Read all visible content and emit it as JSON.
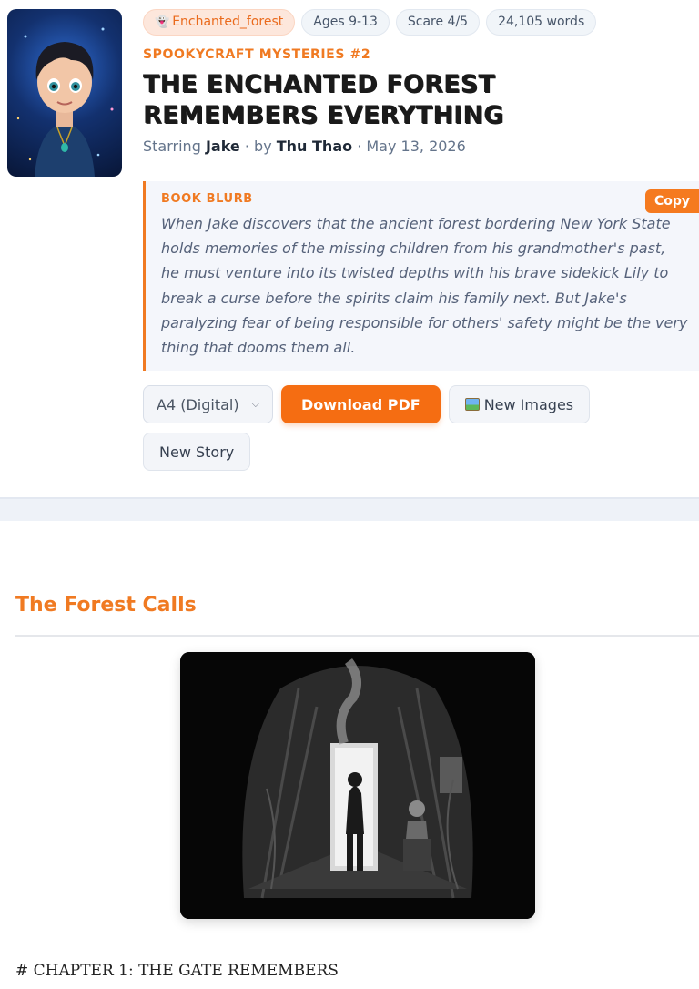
{
  "book": {
    "tags": {
      "theme": "Enchanted_forest",
      "theme_icon": "ghost-icon",
      "ages": "Ages 9-13",
      "scare": "Scare 4/5",
      "words": "24,105 words"
    },
    "series": "SPOOKYCRAFT MYSTERIES #2",
    "title": "THE ENCHANTED FOREST REMEMBERS EVERYTHING",
    "byline": {
      "starring_label": "Starring",
      "hero": "Jake",
      "by_label": "· by",
      "author": "Thu Thao",
      "date": "· May 13, 2026"
    }
  },
  "blurb": {
    "label": "BOOK BLURB",
    "copy_label": "Copy",
    "text": "When Jake discovers that the ancient forest bordering New York State holds memories of the missing children from his grandmother's past, he must venture into its twisted depths with his brave sidekick Lily to break a curse before the spirits claim his family next. But Jake's paralyzing fear of being responsible for others' safety might be the very thing that dooms them all."
  },
  "controls": {
    "format_selected": "A4 (Digital)",
    "download_label": "Download PDF",
    "new_images_label": "New Images",
    "new_story_label": "New Story"
  },
  "chapter": {
    "heading": "The Forest Calls",
    "text_start": "# CHAPTER 1: THE GATE REMEMBERS"
  },
  "colors": {
    "accent": "#f07a22",
    "primary_button": "#f56d12"
  }
}
